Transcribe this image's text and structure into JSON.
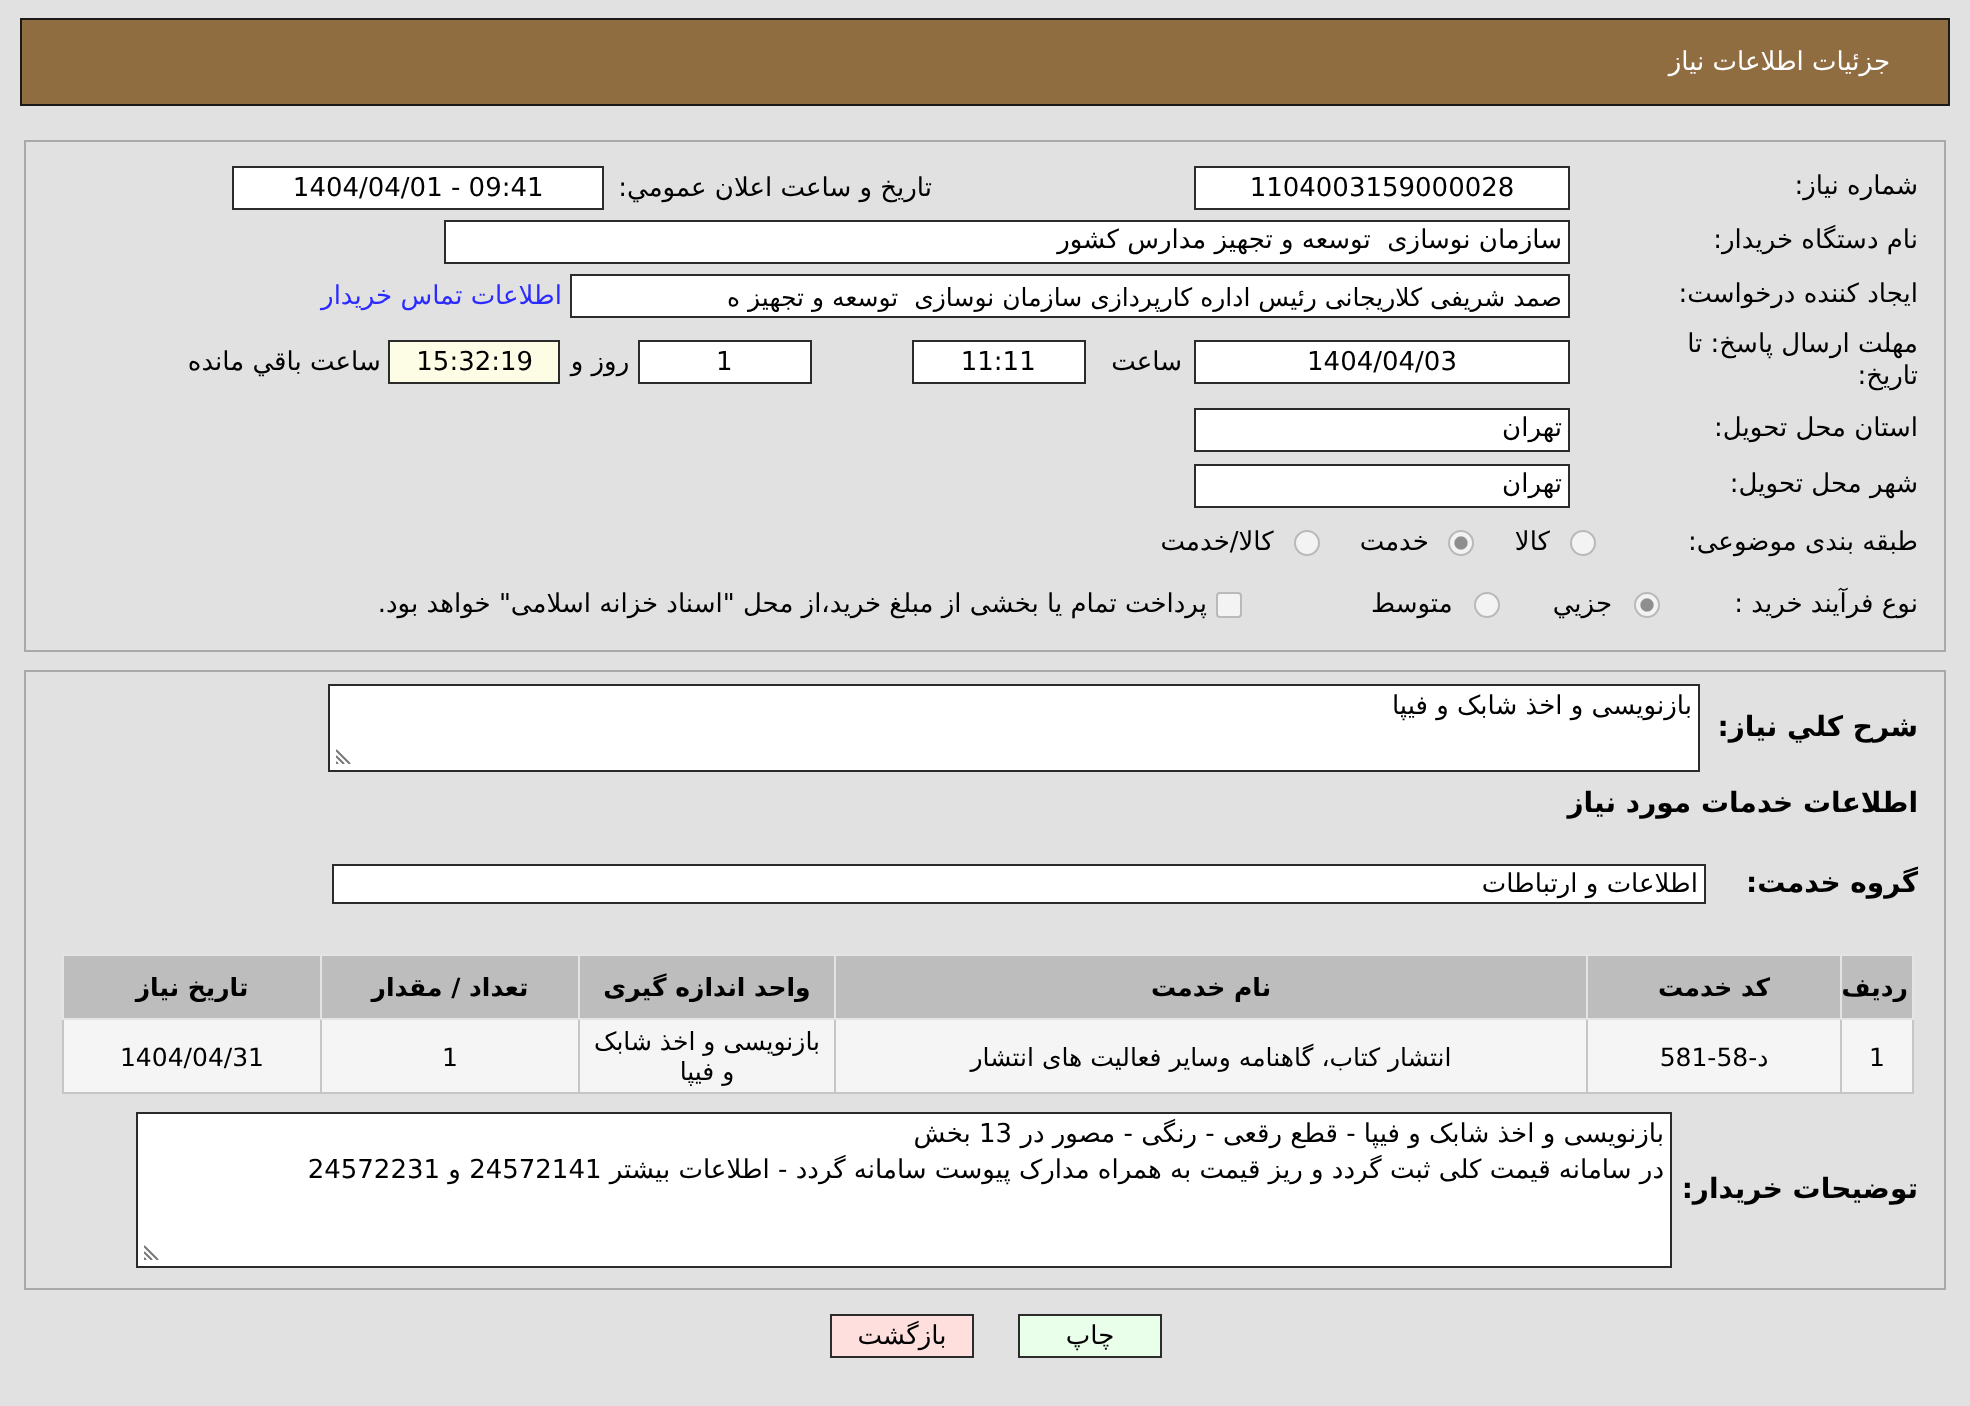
{
  "header": {
    "title": "جزئیات اطلاعات نیاز"
  },
  "details": {
    "need_number": {
      "label": "شماره نیاز:",
      "value": "1104003159000028"
    },
    "announcement": {
      "label": "تاریخ و ساعت اعلان عمومي:",
      "value": "1404/04/01 - 09:41"
    },
    "buyer_org": {
      "label": "نام دستگاه خریدار:",
      "value": "سازمان نوسازی  توسعه و تجهیز مدارس کشور"
    },
    "requester": {
      "label": "ایجاد کننده درخواست:",
      "value": "صمد شریفی کلاریجانی رئیس اداره کارپردازی سازمان نوسازی  توسعه و تجهیز ه",
      "contact_link": "اطلاعات تماس خریدار"
    },
    "deadline": {
      "label": "مهلت ارسال پاسخ: تا تاریخ:",
      "date": "1404/04/03",
      "time_label": "ساعت",
      "time": "11:11",
      "days": "1",
      "days_label": "روز و",
      "remaining": "15:32:19",
      "remaining_label": "ساعت باقي مانده"
    },
    "province": {
      "label": "استان محل تحویل:",
      "value": "تهران"
    },
    "city": {
      "label": "شهر محل تحویل:",
      "value": "تهران"
    },
    "category": {
      "label": "طبقه بندی موضوعی:",
      "options": [
        {
          "label": "کالا",
          "selected": false
        },
        {
          "label": "خدمت",
          "selected": true
        },
        {
          "label": "کالا/خدمت",
          "selected": false
        }
      ]
    },
    "purchase_type": {
      "label": "نوع فرآیند خرید :",
      "options": [
        {
          "label": "جزيي",
          "selected": true
        },
        {
          "label": "متوسط",
          "selected": false
        }
      ],
      "treasury": {
        "label": "پرداخت تمام یا بخشی از مبلغ خرید،از محل \"اسناد خزانه اسلامی\" خواهد بود.",
        "checked": false
      }
    }
  },
  "need_description": {
    "label": "شرح کلي نیاز:",
    "value": "بازنویسی و اخذ شابک و فیپا"
  },
  "services": {
    "title": "اطلاعات خدمات مورد نیاز",
    "group": {
      "label": "گروه خدمت:",
      "value": "اطلاعات و ارتباطات"
    },
    "table": {
      "columns": [
        "ردیف",
        "کد خدمت",
        "نام خدمت",
        "واحد اندازه گیری",
        "تعداد / مقدار",
        "تاریخ نیاز"
      ],
      "rows": [
        [
          "1",
          "د-58-581",
          "انتشار کتاب، گاهنامه وسایر فعالیت های انتشار",
          "بازنویسی و اخذ شابک و فیپا",
          "1",
          "1404/04/31"
        ]
      ]
    }
  },
  "buyer_notes": {
    "label": "توضیحات خریدار:",
    "value": "بازنویسی و اخذ شابک و فیپا - قطع رقعی - رنگی - مصور در 13 بخش\nدر سامانه قیمت کلی ثبت گردد و ریز قیمت به همراه مدارک پیوست سامانه گردد - اطلاعات بیشتر 24572141 و 24572231"
  },
  "buttons": [
    {
      "label": "چاپ",
      "kind": "print"
    },
    {
      "label": "بازگشت",
      "kind": "back"
    }
  ]
}
